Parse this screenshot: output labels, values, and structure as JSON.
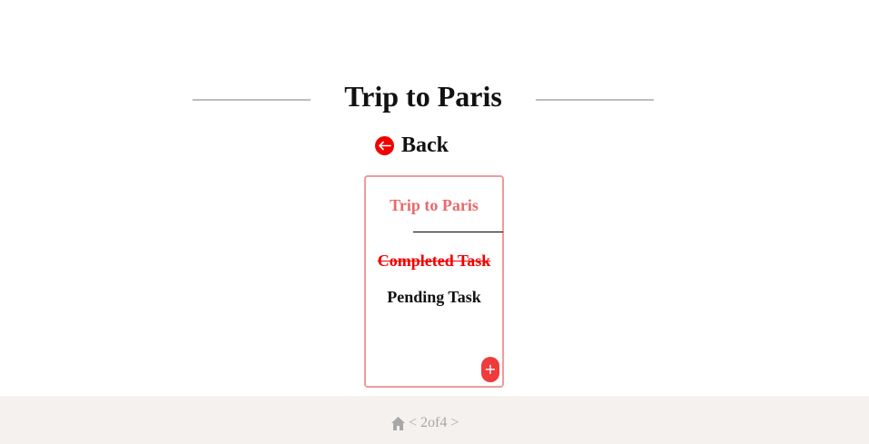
{
  "header": {
    "title": "Trip to Paris"
  },
  "back": {
    "label": "Back",
    "icon": "arrow-left-icon"
  },
  "card": {
    "title": "Trip to Paris",
    "tasks": [
      {
        "label": "Completed Task",
        "status": "completed"
      },
      {
        "label": "Pending Task",
        "status": "pending"
      }
    ],
    "add_label": "+",
    "add_icon": "plus-icon"
  },
  "footer": {
    "home_icon": "home-icon",
    "prev": "<",
    "page_text": "2of4",
    "next": ">"
  },
  "colors": {
    "accent_red": "#f20000",
    "card_border": "#f29a9a",
    "card_title": "#e86a6a",
    "add_button": "#ef3b3b",
    "footer_bg": "#f4f1ef",
    "footer_text": "#a8a8a8"
  }
}
